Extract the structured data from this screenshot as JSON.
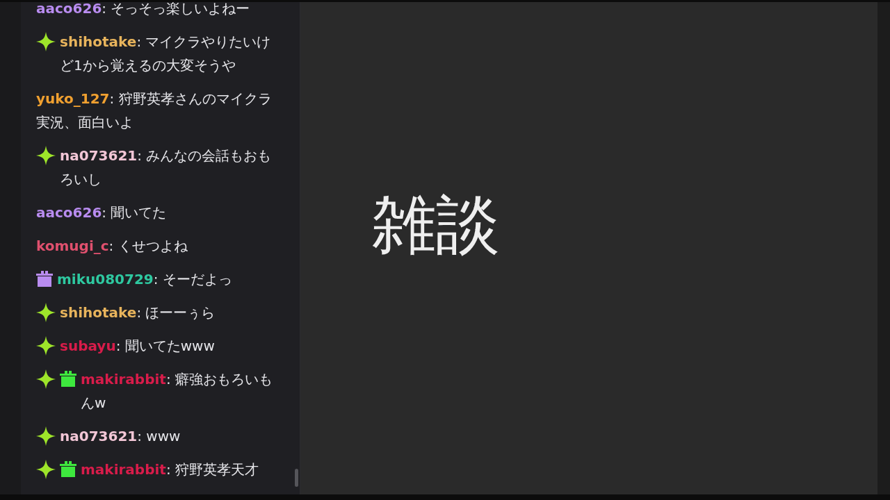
{
  "chat": {
    "messages": [
      {
        "user": "aaco626",
        "color": "#b98cf0",
        "text": ": そっそっ楽しいよねー"
      },
      {
        "user": "shihotake",
        "color": "#e8b45c",
        "badges": [
          {
            "kind": "sparkle"
          }
        ],
        "text": ": マイクラやりたいけど1から覚えるの大変そうや"
      },
      {
        "user": "yuko_127",
        "color": "#f0a030",
        "text": ": 狩野英孝さんのマイクラ実況、面白いよ"
      },
      {
        "user": "na073621",
        "color": "#f2c6d6",
        "badges": [
          {
            "kind": "sparkle"
          }
        ],
        "text": ": みんなの会話もおもろいし"
      },
      {
        "user": "aaco626",
        "color": "#b98cf0",
        "text": ": 聞いてた"
      },
      {
        "user": "komugi_c",
        "color": "#e0506e",
        "text": ": くせつよね"
      },
      {
        "user": "miku080729",
        "color": "#2ec8a0",
        "badges": [
          {
            "kind": "gift",
            "color": "#b98cf0"
          }
        ],
        "text": ": そーだよっ"
      },
      {
        "user": "shihotake",
        "color": "#e8b45c",
        "badges": [
          {
            "kind": "sparkle"
          }
        ],
        "text": ": ほーーぅら"
      },
      {
        "user": "subayu",
        "color": "#d81c4a",
        "badges": [
          {
            "kind": "sparkle"
          }
        ],
        "text": ": 聞いてたwww"
      },
      {
        "user": "makirabbit",
        "color": "#d81c4a",
        "badges": [
          {
            "kind": "sparkle"
          },
          {
            "kind": "gift",
            "color": "#3ee83e"
          }
        ],
        "text": ": 癖強おもろいもんw"
      },
      {
        "user": "na073621",
        "color": "#f2c6d6",
        "badges": [
          {
            "kind": "sparkle"
          }
        ],
        "text": ": www"
      },
      {
        "user": "makirabbit",
        "color": "#d81c4a",
        "badges": [
          {
            "kind": "sparkle"
          },
          {
            "kind": "gift",
            "color": "#3ee83e"
          }
        ],
        "text": ": 狩野英孝天才"
      }
    ]
  },
  "stream": {
    "title": "雑談"
  }
}
